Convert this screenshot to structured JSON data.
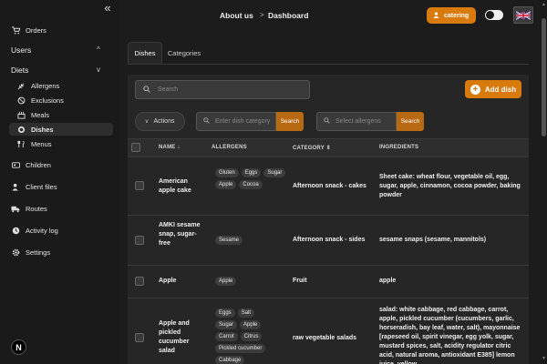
{
  "sidebar": {
    "collapse_icon": "double-chevron-left-icon",
    "orders": "Orders",
    "users": "Users",
    "diets": "Diets",
    "diet_items": [
      {
        "label": "Allergens",
        "icon": "feather-icon"
      },
      {
        "label": "Exclusions",
        "icon": "ban-icon"
      },
      {
        "label": "Meals",
        "icon": "meals-icon"
      },
      {
        "label": "Dishes",
        "icon": "plate-icon"
      },
      {
        "label": "Menus",
        "icon": "cutlery-icon"
      }
    ],
    "children": "Children",
    "client_files": "Client files",
    "routes": "Routes",
    "activity_log": "Activity log",
    "settings": "Settings",
    "avatar_letter": "N"
  },
  "header": {
    "crumb_1": "About us",
    "crumb_sep": ">",
    "crumb_2": "Dashboard",
    "user_label": "catering",
    "language": "English (UK flag)"
  },
  "tabs": [
    {
      "label": "Dishes"
    },
    {
      "label": "Categories"
    }
  ],
  "toolbar": {
    "search_placeholder": "Search",
    "add_label": "Add dish",
    "actions_label": "Actions",
    "dish_category_placeholder": "Enter dish category",
    "dish_category_button": "Search",
    "allergens_placeholder": "Select allergens",
    "allergens_button": "Search"
  },
  "table": {
    "headers": {
      "name": "NAME ↓",
      "allergens": "ALLERGENS",
      "category": "CATEGORY ⇕",
      "ingredients": "INGREDIENTS"
    },
    "rows": [
      {
        "name": "American apple cake",
        "allergens": [
          "Gluten",
          "Eggs",
          "Sugar",
          "Apple",
          "Cocoa"
        ],
        "category": "Afternoon snack - cakes",
        "ingredients": "Sheet cake: wheat flour, vegetable oil, egg, sugar, apple, cinnamon, cocoa powder, baking powder"
      },
      {
        "name": "AMKI sesame snap, sugar-free",
        "allergens": [
          "Sesame"
        ],
        "category": "Afternoon snack - sides",
        "ingredients": "sesame snaps (sesame, mannitols)"
      },
      {
        "name": "Apple",
        "allergens": [
          "Apple"
        ],
        "category": "Fruit",
        "ingredients": "apple"
      },
      {
        "name": "Apple and pickled cucumber salad",
        "allergens": [
          "Eggs",
          "Salt",
          "Sugar",
          "Apple",
          "Carrot",
          "Citrus",
          "Pickled cucumber",
          "Cabbage"
        ],
        "category": "raw vegetable salads",
        "ingredients": "salad: white cabbage, red cabbage, carrot, apple, pickled cucumber (cucumbers, garlic, horseradish, bay leaf, water, salt), mayonnaise [rapeseed oil, spirit vinegar, egg yolk, sugar, mustard spices, salt, acidity regulator citric acid, natural aroma, antioxidant E385] lemon juice, yellow"
      }
    ]
  }
}
